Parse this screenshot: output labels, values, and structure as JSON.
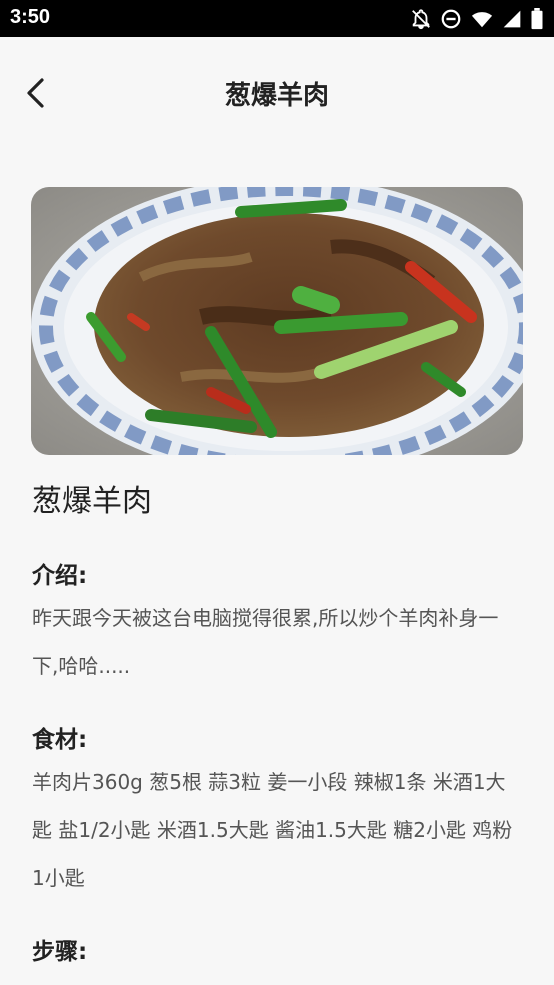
{
  "status_bar": {
    "time": "3:50",
    "icons": [
      "notifications-off-icon",
      "do-not-disturb-icon",
      "wifi-icon",
      "signal-icon",
      "battery-icon"
    ]
  },
  "header": {
    "title": "葱爆羊肉",
    "back_icon": "chevron-left-icon"
  },
  "recipe": {
    "name": "葱爆羊肉",
    "intro_label": "介绍:",
    "intro_text": "昨天跟今天被这台电脑搅得很累,所以炒个羊肉补身一下,哈哈.....",
    "ingredients_label": "食材:",
    "ingredients_text": "羊肉片360g 葱5根 蒜3粒 姜一小段 辣椒1条 米酒1大匙 盐1/2小匙 米酒1.5大匙 酱油1.5大匙 糖2小匙 鸡粉1小匙",
    "steps_label": "步骤:"
  },
  "colors": {
    "background": "#f7f7f7",
    "status_bar": "#000000",
    "title_text": "#222222",
    "body_text": "#555555"
  }
}
